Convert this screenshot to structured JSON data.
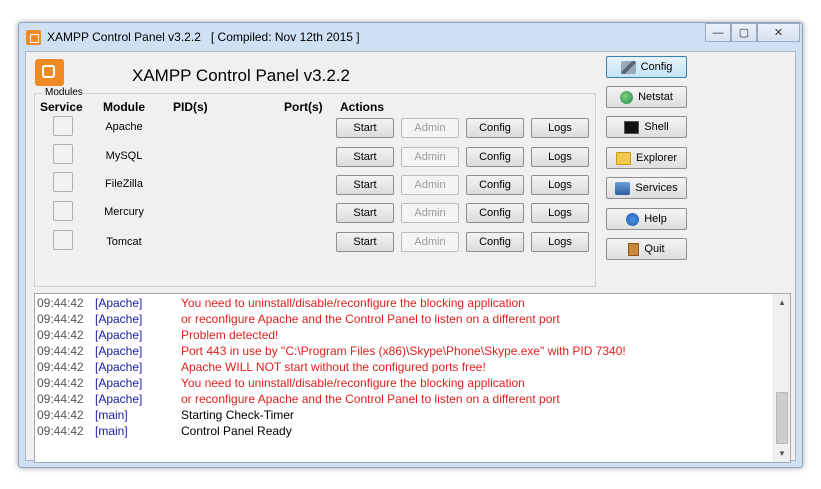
{
  "window": {
    "title": "XAMPP Control Panel v3.2.2   [ Compiled: Nov 12th 2015 ]",
    "controls": {
      "minimize": "—",
      "maximize": "▢",
      "close": "✕"
    }
  },
  "header": {
    "title": "XAMPP Control Panel v3.2.2"
  },
  "modules_group_label": "Modules",
  "columns": {
    "service": "Service",
    "module": "Module",
    "pids": "PID(s)",
    "ports": "Port(s)",
    "actions": "Actions"
  },
  "modules": [
    {
      "name": "Apache",
      "start": "Start",
      "admin": "Admin",
      "config": "Config",
      "logs": "Logs"
    },
    {
      "name": "MySQL",
      "start": "Start",
      "admin": "Admin",
      "config": "Config",
      "logs": "Logs"
    },
    {
      "name": "FileZilla",
      "start": "Start",
      "admin": "Admin",
      "config": "Config",
      "logs": "Logs"
    },
    {
      "name": "Mercury",
      "start": "Start",
      "admin": "Admin",
      "config": "Config",
      "logs": "Logs"
    },
    {
      "name": "Tomcat",
      "start": "Start",
      "admin": "Admin",
      "config": "Config",
      "logs": "Logs"
    }
  ],
  "side_buttons": [
    {
      "label": "Config",
      "icon": "wrench-icon"
    },
    {
      "label": "Netstat",
      "icon": "globe-icon"
    },
    {
      "label": "Shell",
      "icon": "terminal-icon"
    },
    {
      "label": "Explorer",
      "icon": "folder-icon"
    },
    {
      "label": "Services",
      "icon": "services-icon"
    },
    {
      "label": "Help",
      "icon": "help-icon"
    },
    {
      "label": "Quit",
      "icon": "door-icon"
    }
  ],
  "log": [
    {
      "time": "09:44:42",
      "module": "[Apache]",
      "message": "You need to uninstall/disable/reconfigure the blocking application",
      "level": "error"
    },
    {
      "time": "09:44:42",
      "module": "[Apache]",
      "message": "or reconfigure Apache and the Control Panel to listen on a different port",
      "level": "error"
    },
    {
      "time": "09:44:42",
      "module": "[Apache]",
      "message": "Problem detected!",
      "level": "error"
    },
    {
      "time": "09:44:42",
      "module": "[Apache]",
      "message": "Port 443 in use by \"C:\\Program Files (x86)\\Skype\\Phone\\Skype.exe\" with PID 7340!",
      "level": "error"
    },
    {
      "time": "09:44:42",
      "module": "[Apache]",
      "message": "Apache WILL NOT start without the configured ports free!",
      "level": "error"
    },
    {
      "time": "09:44:42",
      "module": "[Apache]",
      "message": "You need to uninstall/disable/reconfigure the blocking application",
      "level": "error"
    },
    {
      "time": "09:44:42",
      "module": "[Apache]",
      "message": "or reconfigure Apache and the Control Panel to listen on a different port",
      "level": "error"
    },
    {
      "time": "09:44:42",
      "module": "[main]",
      "message": "Starting Check-Timer",
      "level": "info"
    },
    {
      "time": "09:44:42",
      "module": "[main]",
      "message": "Control Panel Ready",
      "level": "info"
    }
  ],
  "colors": {
    "error": "#e0211e",
    "module": "#1a1aa6",
    "accent": "#f08a24"
  }
}
